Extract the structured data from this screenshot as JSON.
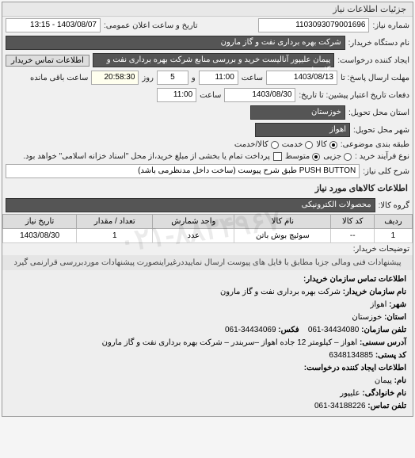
{
  "watermark": "۰۲۱-۸۸۳۴۹۶۷۰",
  "panel_title": "جزئیات اطلاعات نیاز",
  "header": {
    "req_no_label": "شماره نیاز:",
    "req_no": "1103093079001696",
    "announce_label": "تاریخ و ساعت اعلان عمومی:",
    "announce_value": "1403/08/07 - 13:15",
    "buyer_label": "نام دستگاه خریدار:",
    "buyer_value": "شرکت بهره برداری نفت و گاز مارون",
    "creator_label": "ایجاد کننده درخواست:",
    "creator_value": "پیمان علیپور آنالیست خرید و بررسی منابع شرکت بهره برداری نفت و گاز مارون",
    "contact_btn": "اطلاعات تماس خریدار",
    "deadline_label": "مهلت ارسال پاسخ: تا",
    "deadline_date": "1403/08/13",
    "deadline_time_label": "ساعت",
    "deadline_time": "11:00",
    "days_label": "و",
    "days_value": "5",
    "days_after": "روز",
    "remain_label": "ساعت باقی مانده",
    "remain_value": "20:58:30",
    "delivery_history_label": "دفعات تاریخ اعتبار پیشین: تا تاریخ:",
    "delivery_date": "1403/08/30",
    "delivery_time_label": "ساعت",
    "delivery_time": "11:00",
    "province_label": "استان محل تحویل:",
    "province_value": "خوزستان",
    "city_label": "شهر محل تحویل:",
    "city_value": "اهواز",
    "category_label": "طبقه بندی موضوعی:",
    "cat_goods": "کالا",
    "cat_service": "خدمت",
    "cat_goodservice": "کالا/خدمت",
    "purchase_type_label": "نوع فرآیند خرید :",
    "pt_retail": "جزیی",
    "pt_medium": "متوسط",
    "pt_note": "پرداخت تمام یا بخشی از مبلغ خرید،از محل \"اسناد خزانه اسلامی\" خواهد بود.",
    "desc_label": "شرح کلی نیاز:",
    "desc_value": "PUSH BUTTON طبق شرح پیوست (ساخت داخل مدنظرمی باشد)"
  },
  "items_section_title": "اطلاعات کالاهای مورد نیاز",
  "items_group_label": "گروه کالا:",
  "items_group_value": "محصولات الکترونیکی",
  "table": {
    "headers": [
      "ردیف",
      "کد کالا",
      "نام کالا",
      "واحد شمارش",
      "تعداد / مقدار",
      "تاریخ نیاز"
    ],
    "row": [
      "1",
      "--",
      "سوئیچ بوش باتن",
      "عدد",
      "1",
      "1403/08/30"
    ]
  },
  "buyer_note_label": "توضیحات خریدار:",
  "buyer_note": "پیشنهادات فنی ومالی جزبا مطابق با فایل های پیوست ارسال نماییددرغیراینصورت پیشنهادات موردبررسی قرارنمی گیرد",
  "contact": {
    "section_title": "اطلاعات تماس سازمان خریدار:",
    "org_label": "نام سازمان خریدار:",
    "org_value": "شرکت بهره برداری نفت و گاز مارون",
    "city_label": "شهر:",
    "city_value": "اهواز",
    "province_label": "استان:",
    "province_value": "خوزستان",
    "phone_label": "تلفن سازمان:",
    "phone_value": "34434080-061",
    "fax_label": "فکس:",
    "fax_value": "34434069-061",
    "address_label": "آدرس سسنی:",
    "address_value": "اهواز – کیلومتر 12 جاده اهواز –سربندر – شرکت بهره برداری نفت و گاز مارون",
    "postal_label": "کد پستی:",
    "postal_value": "6348134885",
    "creator_section": "اطلاعات ایجاد کننده درخواست:",
    "name_label": "نام:",
    "name_value": "پیمان",
    "family_label": "نام خانوادگی:",
    "family_value": "علیپور",
    "tel_label": "تلفن تماس:",
    "tel_value": "34188226-061"
  }
}
